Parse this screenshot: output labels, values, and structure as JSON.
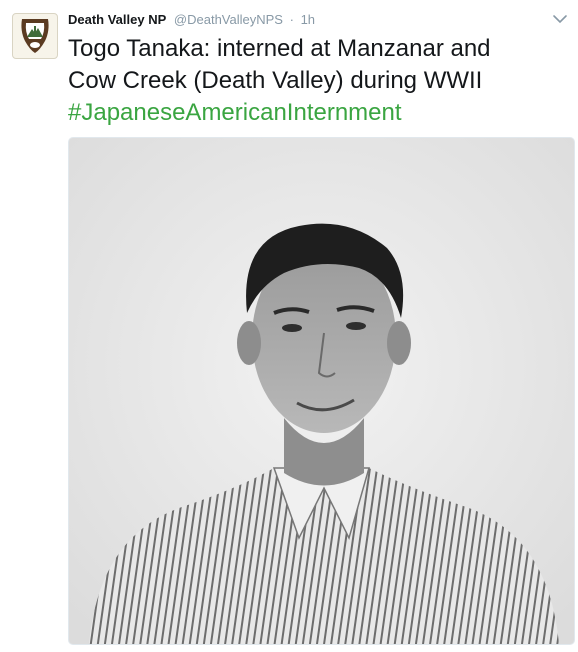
{
  "tweet": {
    "author_name": "Death Valley NP",
    "author_handle": "@DeathValleyNPS",
    "separator": "·",
    "time": "1h",
    "text_line1": "Togo Tanaka: interned at Manzanar and",
    "text_line2": "Cow Creek (Death Valley) during WWII",
    "hashtag": "#JapaneseAmericanInternment"
  },
  "icons": {
    "avatar": "nps-arrowhead-logo-icon",
    "more": "chevron-down-icon"
  },
  "colors": {
    "hashtag": "#3aa541",
    "muted": "#8899a6",
    "text": "#14171a",
    "nps_brown": "#5b3b22",
    "nps_green": "#3f6b3a"
  }
}
